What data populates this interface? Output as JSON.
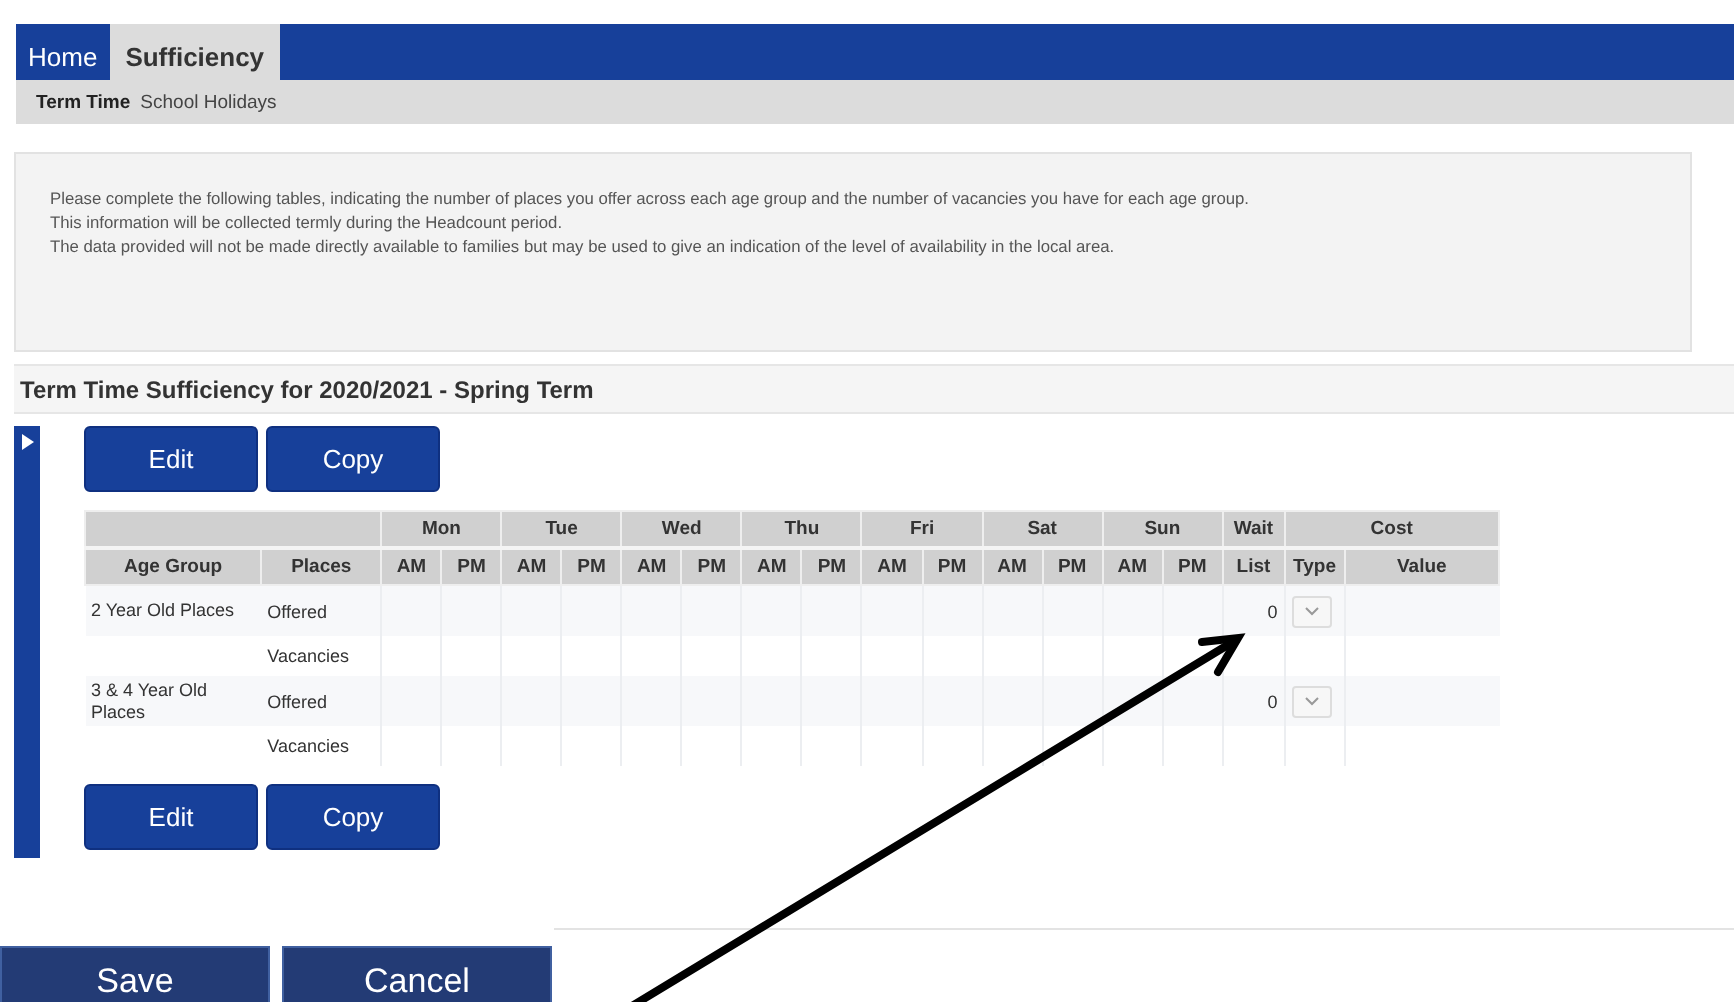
{
  "nav": {
    "tabs": [
      {
        "label": "Home",
        "selected": false
      },
      {
        "label": "Sufficiency",
        "selected": true
      }
    ]
  },
  "subnav": {
    "tabs": [
      {
        "label": "Term Time",
        "selected": true
      },
      {
        "label": "School Holidays",
        "selected": false
      }
    ]
  },
  "info": {
    "lines": [
      "Please complete the following tables, indicating the number of places you offer across each age group and the number of vacancies you have for each age group.",
      "This information will be collected termly during the Headcount period.",
      "The data provided will not be made directly available to families but may be used to give an indication of the level of availability in the local area."
    ]
  },
  "section": {
    "title": "Term Time Sufficiency for 2020/2021 - Spring Term",
    "expanded": false
  },
  "top_buttons": [
    "Edit",
    "Copy"
  ],
  "table": {
    "groups": [
      "Mon",
      "Tue",
      "Wed",
      "Thu",
      "Fri",
      "Sat",
      "Sun",
      "Wait",
      "Cost"
    ],
    "columns": [
      "Age Group",
      "Places",
      "AM",
      "PM",
      "AM",
      "PM",
      "AM",
      "PM",
      "AM",
      "PM",
      "AM",
      "PM",
      "AM",
      "PM",
      "AM",
      "PM",
      "List",
      "Type",
      "Value"
    ],
    "rows": [
      {
        "age_group": "2 Year Old Places",
        "places": "Offered",
        "wait_list": "0",
        "type_select": true
      },
      {
        "places": "Vacancies"
      },
      {
        "age_group": "3 & 4 Year Old Places",
        "places": "Offered",
        "wait_list": "0",
        "type_select": true
      },
      {
        "places": "Vacancies"
      }
    ]
  },
  "bottom_buttons": [
    "Edit",
    "Copy"
  ],
  "form_buttons": [
    "Save",
    "Cancel"
  ]
}
